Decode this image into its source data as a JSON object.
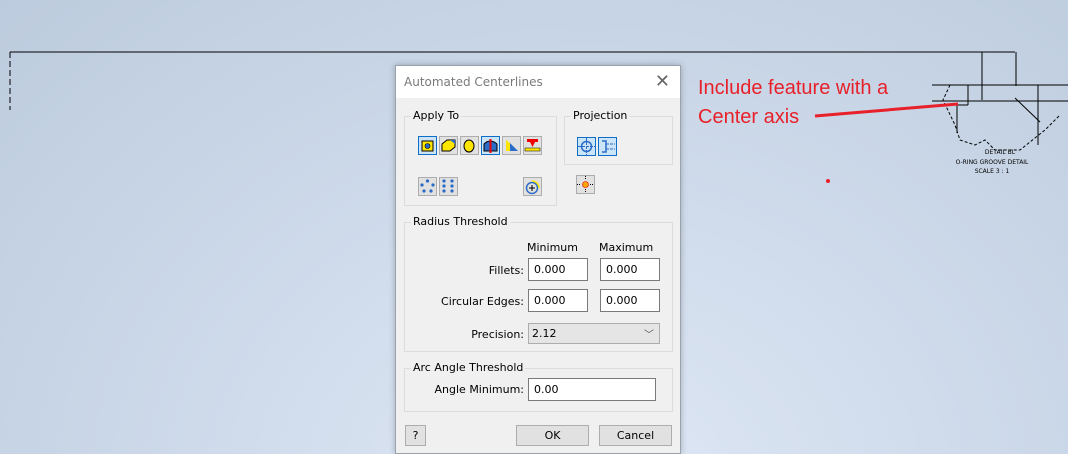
{
  "annotation": {
    "line1": "Include feature with a",
    "line2": "Center axis",
    "color": "#e8202a"
  },
  "drawing": {
    "detail_title": "DETAIL BL",
    "detail_name": "O-RING GROOVE DETAIL",
    "scale": "SCALE 3 : 1"
  },
  "dialog": {
    "title": "Automated Centerlines",
    "apply_to": {
      "label": "Apply To",
      "icons": [
        "hole-feature-icon",
        "fillet-feature-icon",
        "cylindrical-feature-icon",
        "revolved-feature-icon",
        "chamfer-feature-icon",
        "punch-feature-icon",
        "circular-pattern-icon",
        "rectangular-pattern-icon",
        "sketch-circle-icon"
      ]
    },
    "projection": {
      "label": "Projection",
      "icons": [
        "axis-normal-icon",
        "axis-parallel-icon",
        "center-point-icon"
      ]
    },
    "radius": {
      "label": "Radius Threshold",
      "min_header": "Minimum",
      "max_header": "Maximum",
      "fillets_label": "Fillets:",
      "fillets_min": "0.000",
      "fillets_max": "0.000",
      "circular_label": "Circular Edges:",
      "circular_min": "0.000",
      "circular_max": "0.000",
      "precision_label": "Precision:",
      "precision_value": "2.12"
    },
    "arc": {
      "label": "Arc Angle Threshold",
      "angle_label": "Angle Minimum:",
      "angle_value": "0.00"
    },
    "ok": "OK",
    "cancel": "Cancel"
  }
}
